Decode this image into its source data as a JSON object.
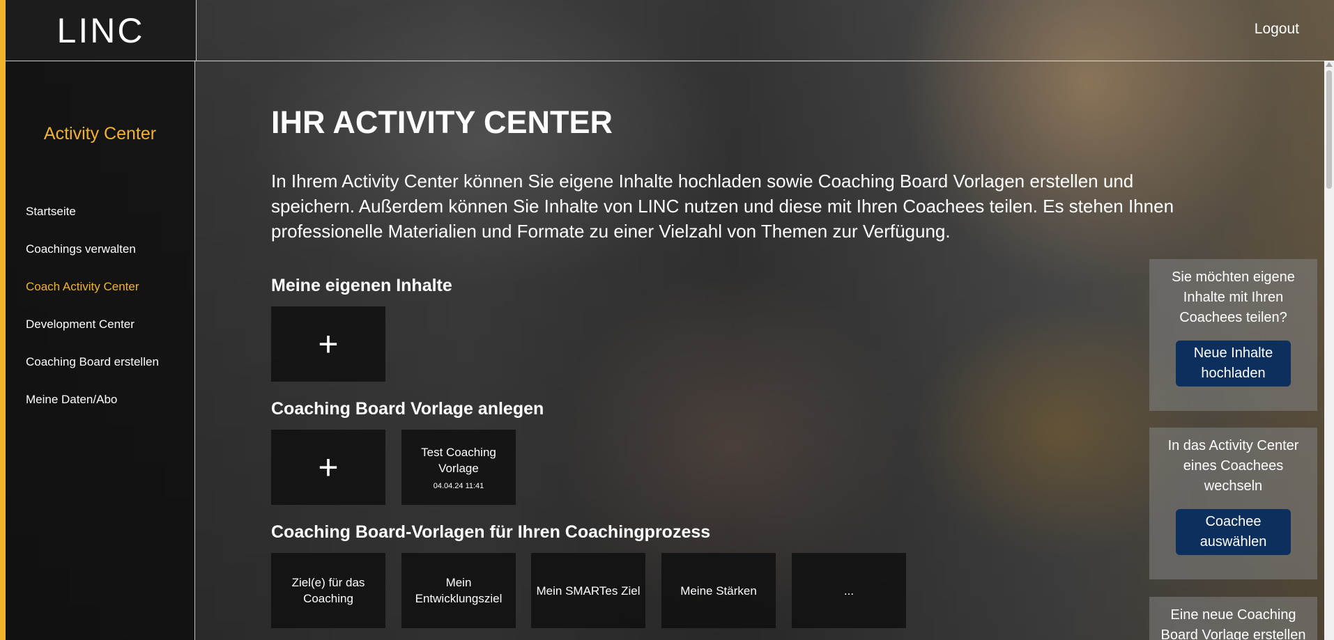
{
  "header": {
    "logo": "LINC",
    "logout": "Logout"
  },
  "sidebar": {
    "title": "Activity Center",
    "items": [
      {
        "label": "Startseite",
        "active": false
      },
      {
        "label": "Coachings verwalten",
        "active": false
      },
      {
        "label": "Coach Activity Center",
        "active": true
      },
      {
        "label": "Development Center",
        "active": false
      },
      {
        "label": "Coaching Board erstellen",
        "active": false
      },
      {
        "label": "Meine Daten/Abo",
        "active": false
      }
    ]
  },
  "main": {
    "title": "IHR ACTIVITY CENTER",
    "intro": "In Ihrem Activity Center können Sie eigene Inhalte hochladen sowie Coaching Board Vorlagen erstellen und speichern. Außerdem können Sie Inhalte von LINC nutzen und diese mit Ihren Coachees teilen. Es stehen Ihnen professionelle Materialien und Formate zu einer Vielzahl von Themen zur Verfügung.",
    "own_content": {
      "heading": "Meine eigenen Inhalte",
      "add": "+"
    },
    "board_template": {
      "heading": "Coaching Board Vorlage anlegen",
      "add": "+",
      "tile_title": "Test Coaching Vorlage",
      "tile_date": "04.04.24 11:41"
    },
    "process_templates": {
      "heading": "Coaching Board-Vorlagen für Ihren Coachingprozess",
      "tiles": [
        "Ziel(e) für das Coaching",
        "Mein Entwicklungsziel",
        "Mein SMARTes Ziel",
        "Meine Stärken",
        "..."
      ]
    }
  },
  "right_panels": [
    {
      "text": "Sie möchten eigene Inhalte mit Ihren Coachees teilen?",
      "button": "Neue Inhalte hochladen"
    },
    {
      "text": "In das Activity Center eines Coachees wechseln",
      "button": "Coachee auswählen"
    },
    {
      "text": "Eine neue Coaching Board Vorlage erstellen"
    }
  ],
  "colors": {
    "accent": "#f2b22c",
    "button": "#0d2f5e"
  }
}
